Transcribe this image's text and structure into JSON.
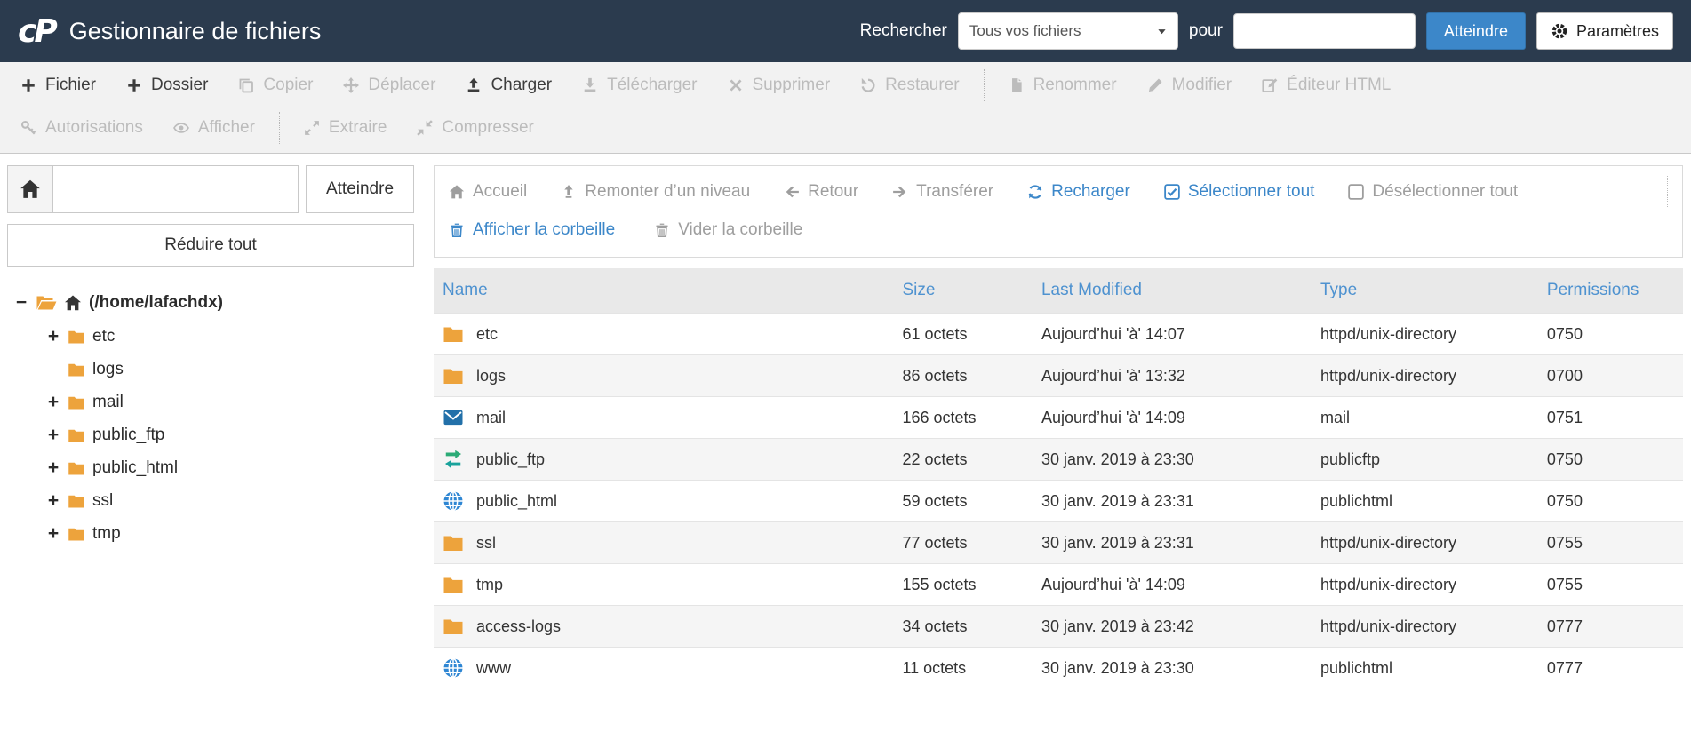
{
  "header": {
    "logo_text": "cP",
    "title": "Gestionnaire de fichiers",
    "search_label": "Rechercher",
    "search_scope_selected": "Tous vos fichiers",
    "search_preposition": "pour",
    "search_input_value": "",
    "go_button_label": "Atteindre",
    "settings_button_label": "Paramètres"
  },
  "toolbar": {
    "row1": [
      {
        "label": "Fichier",
        "icon": "plus",
        "enabled": true
      },
      {
        "label": "Dossier",
        "icon": "plus",
        "enabled": true
      },
      {
        "label": "Copier",
        "icon": "copy",
        "enabled": false
      },
      {
        "label": "Déplacer",
        "icon": "move",
        "enabled": false
      },
      {
        "label": "Charger",
        "icon": "upload",
        "enabled": true
      },
      {
        "label": "Télécharger",
        "icon": "download",
        "enabled": false
      },
      {
        "label": "Supprimer",
        "icon": "delete-x",
        "enabled": false
      },
      {
        "label": "Restaurer",
        "icon": "restore",
        "enabled": false
      },
      {
        "label": "Renommer",
        "icon": "rename-file",
        "enabled": false
      },
      {
        "label": "Modifier",
        "icon": "pencil",
        "enabled": false
      },
      {
        "label": "Éditeur HTML",
        "icon": "html-editor",
        "enabled": false
      }
    ],
    "row2": [
      {
        "label": "Autorisations",
        "icon": "key",
        "enabled": false
      },
      {
        "label": "Afficher",
        "icon": "eye",
        "enabled": false
      },
      {
        "label": "Extraire",
        "icon": "extract",
        "enabled": false
      },
      {
        "label": "Compresser",
        "icon": "compress",
        "enabled": false
      }
    ]
  },
  "sidebar": {
    "path_input_value": "",
    "go_button_label": "Atteindre",
    "collapse_all_label": "Réduire tout",
    "tree_root_toggle": "−",
    "tree_root_label": "(/home/lafachdx)",
    "tree_items": [
      {
        "label": "etc",
        "toggle": "+"
      },
      {
        "label": "logs",
        "toggle": ""
      },
      {
        "label": "mail",
        "toggle": "+"
      },
      {
        "label": "public_ftp",
        "toggle": "+"
      },
      {
        "label": "public_html",
        "toggle": "+"
      },
      {
        "label": "ssl",
        "toggle": "+"
      },
      {
        "label": "tmp",
        "toggle": "+"
      }
    ]
  },
  "filepane": {
    "nav_row1": [
      {
        "label": "Accueil",
        "icon": "home",
        "state": "disabled"
      },
      {
        "label": "Remonter d’un niveau",
        "icon": "level-up",
        "state": "disabled"
      },
      {
        "label": "Retour",
        "icon": "arrow-left",
        "state": "disabled"
      },
      {
        "label": "Transférer",
        "icon": "arrow-right",
        "state": "disabled"
      },
      {
        "label": "Recharger",
        "icon": "reload",
        "state": "active"
      },
      {
        "label": "Sélectionner tout",
        "icon": "checkbox-checked",
        "state": "active"
      },
      {
        "label": "Désélectionner tout",
        "icon": "checkbox-empty",
        "state": "disabled"
      }
    ],
    "nav_row2": [
      {
        "label": "Afficher la corbeille",
        "icon": "trash",
        "state": "active"
      },
      {
        "label": "Vider la corbeille",
        "icon": "trash",
        "state": "disabled"
      }
    ],
    "table": {
      "columns": [
        "Name",
        "Size",
        "Last Modified",
        "Type",
        "Permissions"
      ],
      "rows": [
        {
          "icon": "folder",
          "name": "etc",
          "size": "61 octets",
          "modified": "Aujourd’hui 'à' 14:07",
          "type": "httpd/unix-directory",
          "permissions": "0750"
        },
        {
          "icon": "folder",
          "name": "logs",
          "size": "86 octets",
          "modified": "Aujourd’hui 'à' 13:32",
          "type": "httpd/unix-directory",
          "permissions": "0700"
        },
        {
          "icon": "mail",
          "name": "mail",
          "size": "166 octets",
          "modified": "Aujourd’hui 'à' 14:09",
          "type": "mail",
          "permissions": "0751"
        },
        {
          "icon": "transfer-arrows",
          "name": "public_ftp",
          "size": "22 octets",
          "modified": "30 janv. 2019 à 23:30",
          "type": "publicftp",
          "permissions": "0750"
        },
        {
          "icon": "globe",
          "name": "public_html",
          "size": "59 octets",
          "modified": "30 janv. 2019 à 23:31",
          "type": "publichtml",
          "permissions": "0750"
        },
        {
          "icon": "folder",
          "name": "ssl",
          "size": "77 octets",
          "modified": "30 janv. 2019 à 23:31",
          "type": "httpd/unix-directory",
          "permissions": "0755"
        },
        {
          "icon": "folder",
          "name": "tmp",
          "size": "155 octets",
          "modified": "Aujourd’hui 'à' 14:09",
          "type": "httpd/unix-directory",
          "permissions": "0755"
        },
        {
          "icon": "folder",
          "name": "access-logs",
          "size": "34 octets",
          "modified": "30 janv. 2019 à 23:42",
          "type": "httpd/unix-directory",
          "permissions": "0777"
        },
        {
          "icon": "globe",
          "name": "www",
          "size": "11 octets",
          "modified": "30 janv. 2019 à 23:30",
          "type": "publichtml",
          "permissions": "0777"
        }
      ]
    }
  },
  "colors": {
    "header_bg": "#2b3b4e",
    "accent_blue": "#3c87c9",
    "table_header_blue": "#4e92d0",
    "folder_orange": "#eda33c",
    "mail_blue": "#2270a9",
    "globe_blue": "#2e86d3",
    "disabled_grey": "#bcbcbc",
    "nav_grey": "#9e9e9e",
    "toolbar_bg": "#f2f2f2"
  }
}
